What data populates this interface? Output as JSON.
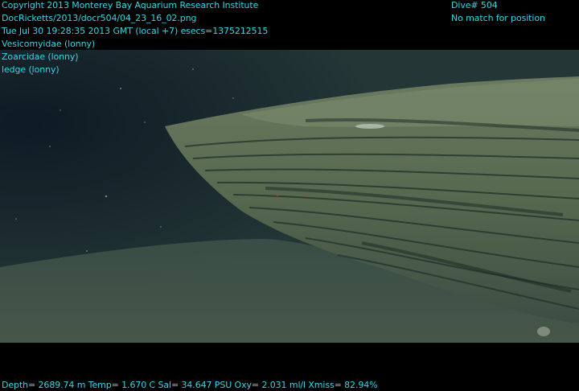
{
  "overlay": {
    "copyright": "Copyright 2013 Monterey Bay Aquarium Research Institute",
    "filename": "DocRicketts/2013/docr504/04_23_16_02.png",
    "timestamp": "Tue Jul 30 19:28:35 2013 GMT (local +7)  esecs=1375212515",
    "annotations": [
      "Vesicomyidae (lonny)",
      "Zoarcidae (lonny)",
      "ledge (lonny)"
    ],
    "dive": "Dive# 504",
    "position": "No match for position",
    "sensors": "Depth= 2689.74 m  Temp= 1.670 C  Sal= 34.647 PSU  Oxy= 2.031 ml/l  Xmiss= 82.94%"
  },
  "colors": {
    "overlay_text": "#36d6e4",
    "letterbox": "#000000"
  },
  "scene": {
    "description_icon": "seafloor-ledge-image"
  }
}
